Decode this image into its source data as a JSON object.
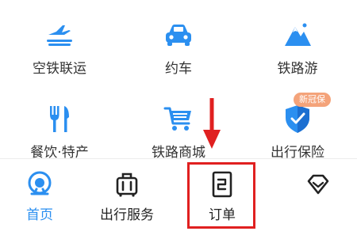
{
  "colors": {
    "accent": "#2b8ff0",
    "icon_dark": "#222222",
    "badge": "#f4a37a",
    "annotation": "#e02020"
  },
  "services": [
    {
      "label": "空铁联运",
      "icon": "plane-train-icon"
    },
    {
      "label": "约车",
      "icon": "car-icon"
    },
    {
      "label": "铁路游",
      "icon": "mountain-icon"
    },
    {
      "label": "餐饮·特产",
      "icon": "fork-knife-icon"
    },
    {
      "label": "铁路商城",
      "icon": "shopping-cart-icon"
    },
    {
      "label": "出行保险",
      "icon": "shield-icon",
      "badge": "新冠保"
    }
  ],
  "tabbar": {
    "items": [
      {
        "label": "首页",
        "icon": "home-train-icon",
        "active": true
      },
      {
        "label": "出行服务",
        "icon": "luggage-icon",
        "active": false
      },
      {
        "label": "订单",
        "icon": "order-document-icon",
        "active": false
      },
      {
        "label": "",
        "icon": "diamond-icon",
        "active": false
      }
    ]
  },
  "annotations": {
    "arrow": "down-arrow",
    "highlight_target": "订单"
  }
}
